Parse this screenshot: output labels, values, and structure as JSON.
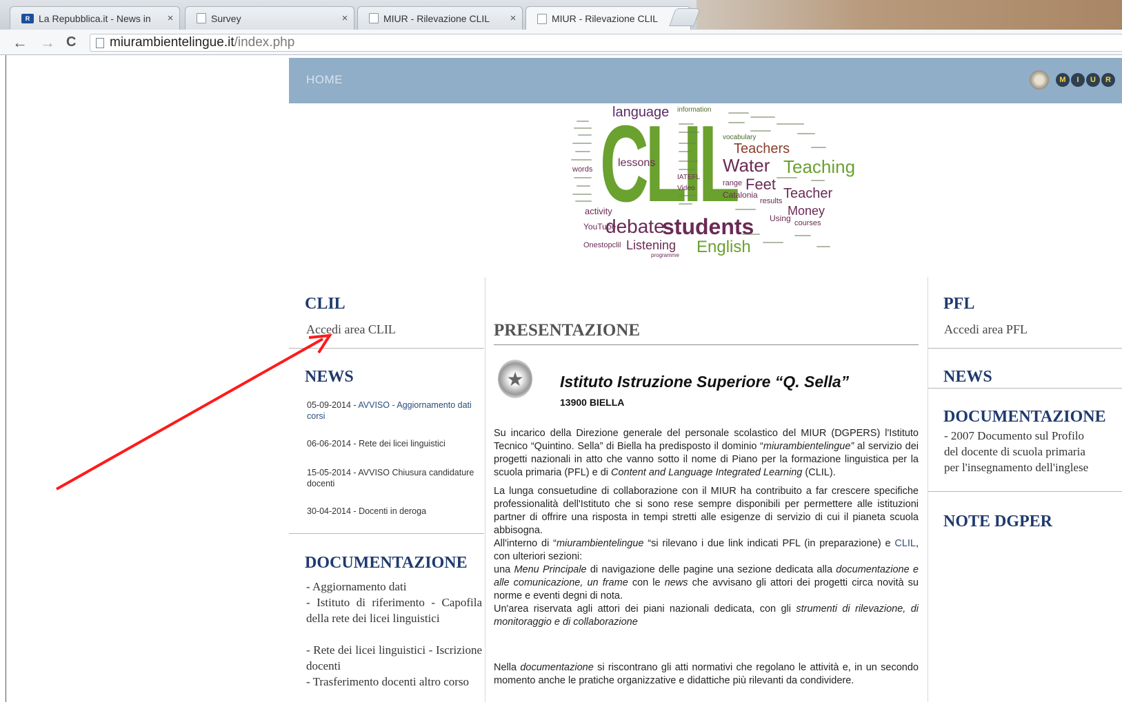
{
  "browser": {
    "tabs": [
      {
        "label": "La Repubblica.it - News in",
        "favicon": "R"
      },
      {
        "label": "Survey"
      },
      {
        "label": "MIUR - Rilevazione CLIL"
      },
      {
        "label": "MIUR - Rilevazione CLIL",
        "active": true
      }
    ],
    "close_glyph": "×",
    "back_glyph": "←",
    "forward_glyph": "→",
    "reload_glyph": "C",
    "url_host": "miurambientelingue.it",
    "url_path": "/index.php"
  },
  "site": {
    "nav_home": "HOME",
    "logo_letters": [
      "M",
      "I",
      "U",
      "R"
    ]
  },
  "wordcloud": {
    "words": [
      "language",
      "information",
      "CLIL",
      "Teachers",
      "Water",
      "Teaching",
      "lessons",
      "Feet",
      "range",
      "Teacher",
      "Catalonia",
      "activity",
      "Money",
      "debate",
      "students",
      "YouTube",
      "Using",
      "courses",
      "Onestopclil",
      "Listening",
      "English",
      "Video",
      "IATEFL",
      "vocabulary",
      "results",
      "words",
      "programme"
    ]
  },
  "left": {
    "clil_title": "CLIL",
    "clil_link": "Accedi area CLIL",
    "news_title": "NEWS",
    "news": [
      {
        "date": "05-09-2014 - ",
        "text": "AVVISO - Aggiornamento dati corsi"
      },
      {
        "date": "06-06-2014 - ",
        "text": "Rete dei licei linguistici"
      },
      {
        "date": "15-05-2014 - ",
        "text": "AVVISO Chiusura candidature docenti"
      },
      {
        "date": "30-04-2014 - ",
        "text": "Docenti in deroga"
      }
    ],
    "doc_title": "DOCUMENTAZIONE",
    "doc_links": [
      "- Aggiornamento dati",
      "- Istituto di riferimento - Capofila della rete dei licei linguistici",
      "- Rete dei licei linguistici - Iscrizione docenti",
      "- Trasferimento docenti altro corso"
    ]
  },
  "center": {
    "title": "PRESENTAZIONE",
    "institute": "Istituto Istruzione Superiore “Q. Sella”",
    "city": "13900 BIELLA",
    "p1a": "Su incarico della Direzione generale del personale scolastico del MIUR (DGPERS) l'Istituto Tecnico “Quintino. Sella” di Biella ha predisposto il dominio “",
    "p1b": "miurambientelingue”",
    "p1c": " al servizio dei progetti nazionali in atto che vanno sotto il nome di Piano per la formazione linguistica per la scuola primaria (PFL) e di ",
    "p1d": "Content and Language Integrated Learning",
    "p1e": " (CLIL).",
    "p2a": "La lunga consuetudine di collaborazione con il MIUR ha contribuito a far crescere specifiche professionalità dell'Istituto che si sono rese sempre disponibili per permettere alle istituzioni partner di offrire una risposta in tempi stretti alle esigenze di servizio di cui il pianeta scuola abbisogna.",
    "p2b": "All'interno di “",
    "p2c": "miurambientelingue",
    "p2d": " “si rilevano i due link indicati PFL (in preparazione) e ",
    "p2e": "CLIL",
    "p2f": ", con ulteriori sezioni:",
    "p2g": "una ",
    "p2h": "Menu Principale",
    "p2i": " di navigazione delle pagine una sezione dedicata alla ",
    "p2j": "documentazione e alle comunicazione, un frame",
    "p2k": " con le ",
    "p2l": "news",
    "p2m": " che avvisano gli attori dei progetti circa novità su norme e eventi degni di nota.",
    "p2n": "Un'area riservata agli attori dei piani nazionali dedicata, con gli ",
    "p2o": "strumenti di rilevazione, di monitoraggio e di collaborazione",
    "p3a": "Nella ",
    "p3b": "documentazione",
    "p3c": " si riscontrano gli atti normativi che regolano le attività e, in un secondo momento anche le pratiche organizzative e didattiche più rilevanti da condividere."
  },
  "right": {
    "pfl_title": "PFL",
    "pfl_link": "Accedi area PFL",
    "news_title": "NEWS",
    "doc_title": "DOCUMENTAZIONE",
    "doc_lines": [
      "- 2007 Documento sul Profilo",
      "del docente di scuola primaria",
      "per l'insegnamento dell'inglese"
    ],
    "note_title": "NOTE DGPER"
  },
  "colors": {
    "header_bg": "#91aec8",
    "section_title": "#1f3a6e",
    "annotation_arrow": "#ff1a1a"
  }
}
